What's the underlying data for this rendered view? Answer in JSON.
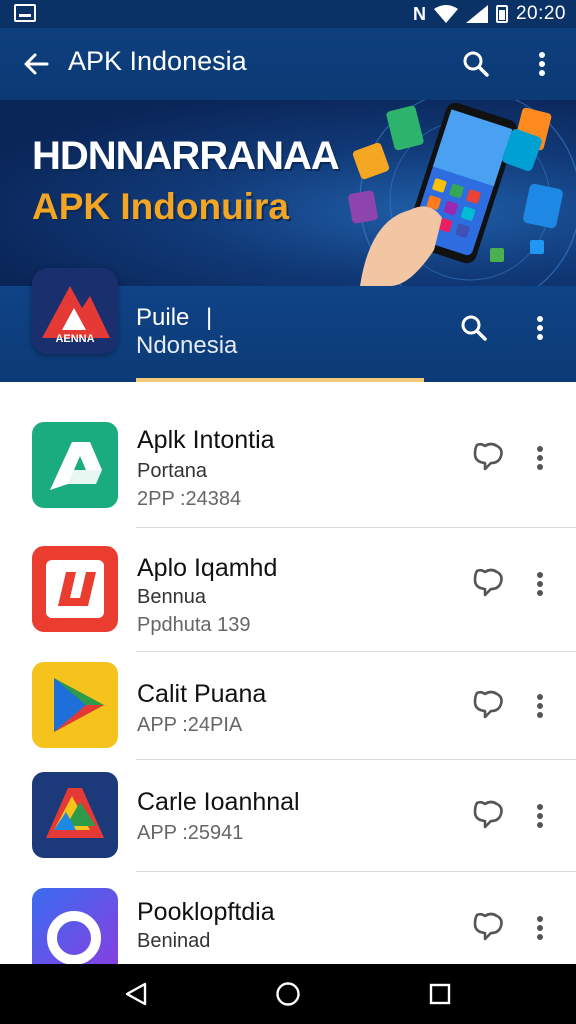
{
  "status_bar": {
    "time": "20:20",
    "nfc_label": "N",
    "icons": [
      "screenshot-icon",
      "nfc-icon",
      "wifi-icon",
      "signal-icon",
      "battery-icon"
    ]
  },
  "app_bar": {
    "title": "APK Indonesia"
  },
  "hero": {
    "line1": "HDNNARRANAA",
    "line2": "APK Indonuira"
  },
  "publisher": {
    "logo_text": "AENNA",
    "name": "Puile",
    "separator": "|",
    "subtitle": "Ndonesia"
  },
  "apps": [
    {
      "name": "Aplk Intontia",
      "sub": "Portana",
      "meta": "2PP  :24384",
      "icon": "letter-a-icon"
    },
    {
      "name": "Aplo Iqamhd",
      "sub": "Bennua",
      "meta": "Ppdhuta 139",
      "icon": "letter-n-icon"
    },
    {
      "name": "Calit Puana",
      "sub": "",
      "meta": "APP  :24PIA",
      "icon": "play-triangle-icon"
    },
    {
      "name": "Carle Ioanhnal",
      "sub": "",
      "meta": "APP  :25941",
      "icon": "colorful-a-icon"
    },
    {
      "name": "Pooklopftdia",
      "sub": "Beninad",
      "meta": "",
      "icon": "ring-icon"
    }
  ],
  "colors": {
    "app_bar": "#0e3f7e",
    "hero_accent": "#f4a623",
    "tab_indicator": "#f0c97a",
    "status_bar": "#0a3266"
  },
  "nav": [
    "back-icon",
    "home-icon",
    "recents-icon"
  ]
}
